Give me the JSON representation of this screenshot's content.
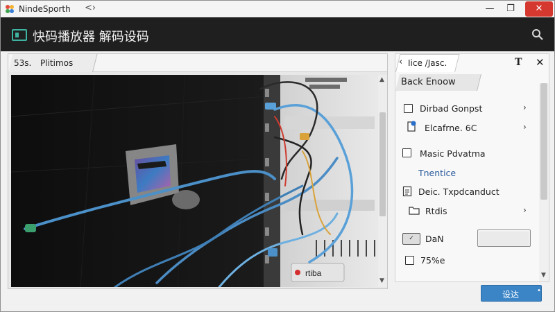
{
  "window": {
    "title": "NindeSporth",
    "back_glyph": "<›",
    "min_glyph": "—",
    "max_glyph": "❐",
    "close_glyph": "✕"
  },
  "header": {
    "title": "快码播放器 解码设码"
  },
  "video_panel": {
    "tab_number": "53s.",
    "tab_label": "Plitimos",
    "overlay_label": "● rtiba"
  },
  "right_panel": {
    "tab_label": "Iice /Jasc.",
    "section_label": "Back Enoow",
    "items": [
      {
        "label": "Dirbad Gonpst"
      },
      {
        "label": "Elcafrne.  6C"
      },
      {
        "label": "Masic Pdvatma"
      },
      {
        "label": "Tnentice"
      },
      {
        "label": "Deic. Txpdcanduct"
      },
      {
        "label": "Rtdis"
      },
      {
        "label": "DaN"
      },
      {
        "label": "75%e"
      }
    ]
  },
  "footer": {
    "ok_label": "设达"
  },
  "colors": {
    "header_bg": "#1f1f1f",
    "accent": "#3b85c7",
    "close_red": "#d5382f",
    "link_blue": "#2a5a9c"
  }
}
